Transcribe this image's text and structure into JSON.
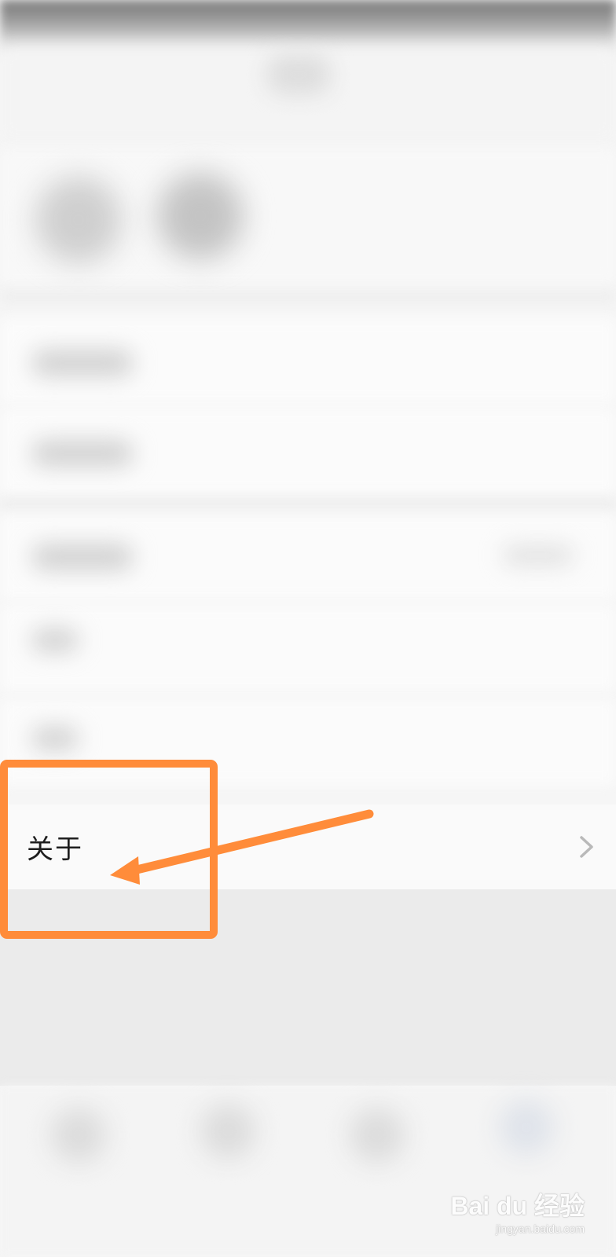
{
  "settings": {
    "about_label": "关于"
  },
  "icons": {
    "chevron": "chevron-right-icon"
  },
  "annotation": {
    "color": "#ff8c3a"
  },
  "watermark": {
    "brand": "Bai du 经验",
    "url": "jingyan.baidu.com"
  }
}
